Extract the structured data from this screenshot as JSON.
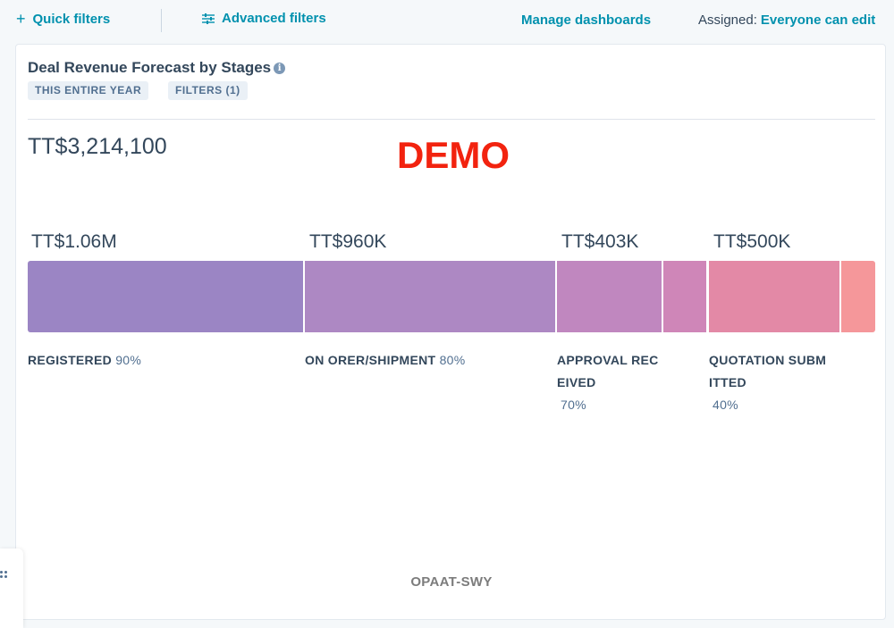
{
  "toolbar": {
    "quick_filters": "Quick filters",
    "advanced_filters": "Advanced filters",
    "manage_dashboards": "Manage dashboards",
    "assigned_label": "Assigned:",
    "assigned_value": "Everyone can edit"
  },
  "report": {
    "title": "Deal Revenue Forecast by Stages",
    "tags": [
      "THIS ENTIRE YEAR",
      "FILTERS (1)"
    ],
    "total": "TT$3,214,100",
    "watermark": "DEMO",
    "footer": "OPAAT-SWY",
    "stages": [
      {
        "amount": "TT$1.06M",
        "label": "REGISTERED",
        "percent": "90%",
        "color": "#9b85c4"
      },
      {
        "amount": "TT$960K",
        "label": "ON ORER/SHIPMENT",
        "percent": "80%",
        "color": "#ad88c3"
      },
      {
        "amount": "TT$403K",
        "label_line1": "APPROVAL REC",
        "label_line2": "EIVED",
        "percent": "70%",
        "color": "#c087bf",
        "secondary_color": "#cf86b8"
      },
      {
        "amount": "TT$500K",
        "label_line1": "QUOTATION SUBM",
        "label_line2": "ITTED",
        "percent": "40%",
        "color": "#e389a6",
        "secondary_color": "#f5979a"
      }
    ]
  },
  "colors": {
    "accent": "#0091ae",
    "text": "#33475b",
    "watermark": "#f2230f"
  }
}
